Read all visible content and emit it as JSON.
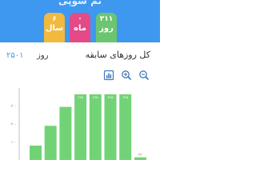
{
  "header": {
    "title": "تم سوپی",
    "background": "#3e98f0",
    "stats": {
      "years": {
        "value": "۶",
        "unit": "سال",
        "color": "#f2b93f"
      },
      "months": {
        "value": "۰",
        "unit": "ماه",
        "color": "#e44a87"
      },
      "days": {
        "value": "۳۱۱",
        "unit": "روز",
        "color": "#6cc570"
      }
    }
  },
  "summary": {
    "title": "کل روزهای سابقه",
    "value": "۲۵۰۱",
    "unit": "روز"
  },
  "toolbar": {
    "icons": [
      "bar-chart-icon",
      "zoom-in-icon",
      "zoom-out-icon"
    ]
  },
  "chart_data": {
    "type": "bar",
    "bar_color": "#72d376",
    "ylim": [
      0,
      400
    ],
    "yticks": [
      "۳۰۰",
      "۲۰۰",
      "۱۰۰"
    ],
    "ytick_values": [
      300,
      200,
      100
    ],
    "categories": [
      "",
      "",
      "",
      "",
      "",
      "",
      ""
    ],
    "values": [
      80,
      190,
      295,
      365,
      365,
      365,
      365,
      15
    ],
    "data_labels": [
      "",
      "",
      "",
      "۳۶۵",
      "۳۶۵",
      "۳۶۵",
      "۳۶۵",
      "۳۱"
    ]
  }
}
